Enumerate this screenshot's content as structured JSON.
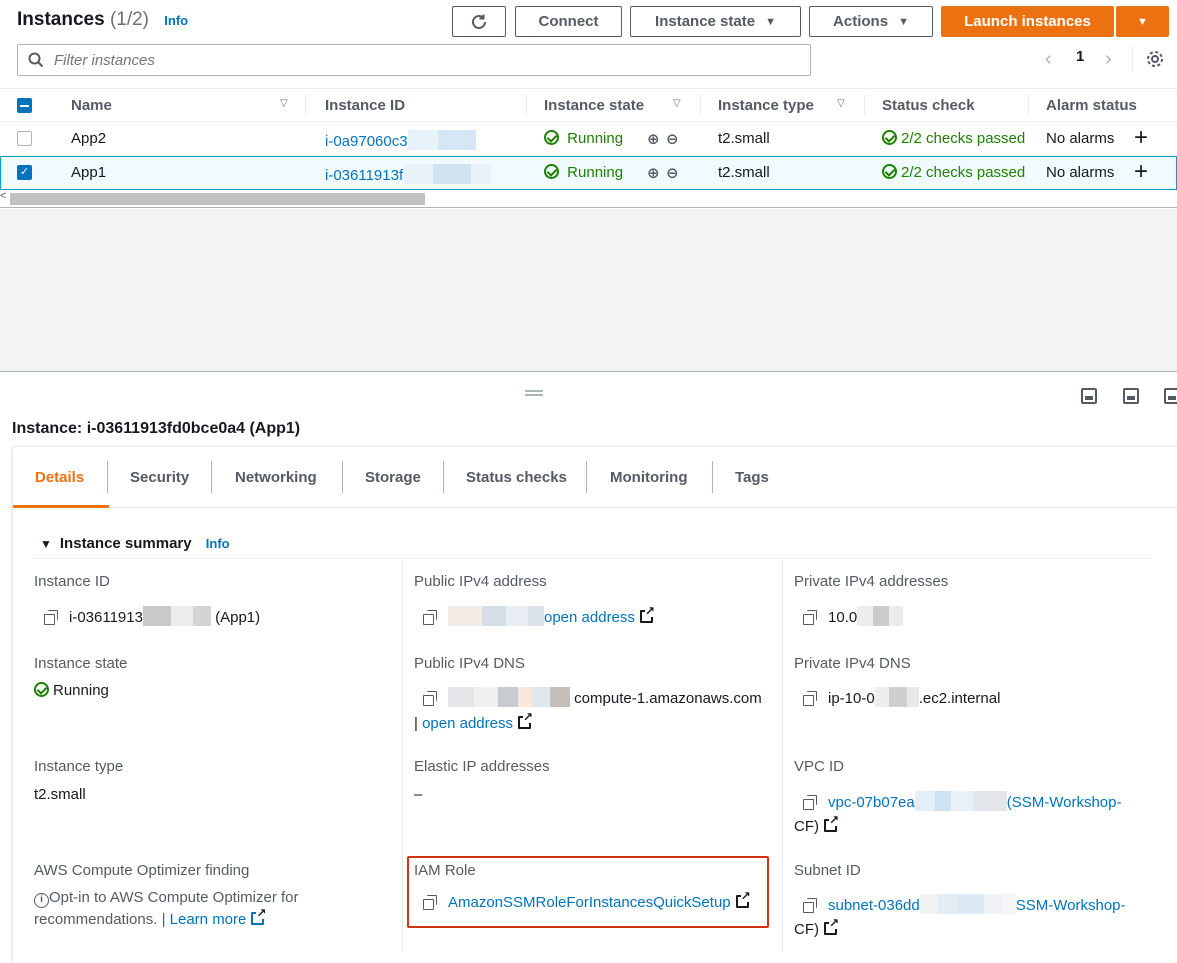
{
  "header": {
    "title": "Instances",
    "count": "(1/2)",
    "info": "Info",
    "connect": "Connect",
    "instance_state": "Instance state",
    "actions": "Actions",
    "launch": "Launch instances"
  },
  "search": {
    "placeholder": "Filter instances"
  },
  "pager": {
    "page": "1"
  },
  "table": {
    "columns": [
      "Name",
      "Instance ID",
      "Instance state",
      "Instance type",
      "Status check",
      "Alarm status"
    ],
    "rows": [
      {
        "name": "App2",
        "id": "i-0a97060c3",
        "state": "Running",
        "type": "t2.small",
        "status": "2/2 checks passed",
        "alarm": "No alarms",
        "selected": false
      },
      {
        "name": "App1",
        "id": "i-03611913f",
        "state": "Running",
        "type": "t2.small",
        "status": "2/2 checks passed",
        "alarm": "No alarms",
        "selected": true
      }
    ]
  },
  "detail": {
    "title": "Instance: i-03611913fd0bce0a4 (App1)",
    "tabs": [
      "Details",
      "Security",
      "Networking",
      "Storage",
      "Status checks",
      "Monitoring",
      "Tags"
    ],
    "section": "Instance summary",
    "section_info": "Info",
    "instance_id_label": "Instance ID",
    "instance_id_value": "i-03611913",
    "instance_id_suffix": "(App1)",
    "public_ipv4_label": "Public IPv4 address",
    "open_address": "open address",
    "private_ipv4_label": "Private IPv4 addresses",
    "private_ipv4_value": "10.0",
    "instance_state_label": "Instance state",
    "instance_state_value": "Running",
    "public_dns_label": "Public IPv4 DNS",
    "public_dns_value": "compute-1.amazonaws.com",
    "public_dns_sep": "|",
    "private_dns_label": "Private IPv4 DNS",
    "private_dns_prefix": "ip-10-0",
    "private_dns_suffix": ".ec2.internal",
    "instance_type_label": "Instance type",
    "instance_type_value": "t2.small",
    "elastic_ip_label": "Elastic IP addresses",
    "elastic_ip_value": "–",
    "vpc_label": "VPC ID",
    "vpc_prefix": "vpc-07b07ea",
    "vpc_suffix": "(SSM-Workshop-",
    "vpc_suffix2": "CF)",
    "optimizer_label": "AWS Compute Optimizer finding",
    "optimizer_text": "Opt-in to AWS Compute Optimizer for",
    "optimizer_text2": "recommendations.",
    "optimizer_sep": "|",
    "learn_more": "Learn more",
    "iam_label": "IAM Role",
    "iam_value": "AmazonSSMRoleForInstancesQuickSetup",
    "subnet_label": "Subnet ID",
    "subnet_prefix": "subnet-036dd",
    "subnet_suffix": "SSM-Workshop-",
    "subnet_suffix2": "CF)"
  },
  "colors": {
    "accent": "#ec7211",
    "link": "#0073bb",
    "success": "#1d8102",
    "highlight": "#d13212"
  }
}
